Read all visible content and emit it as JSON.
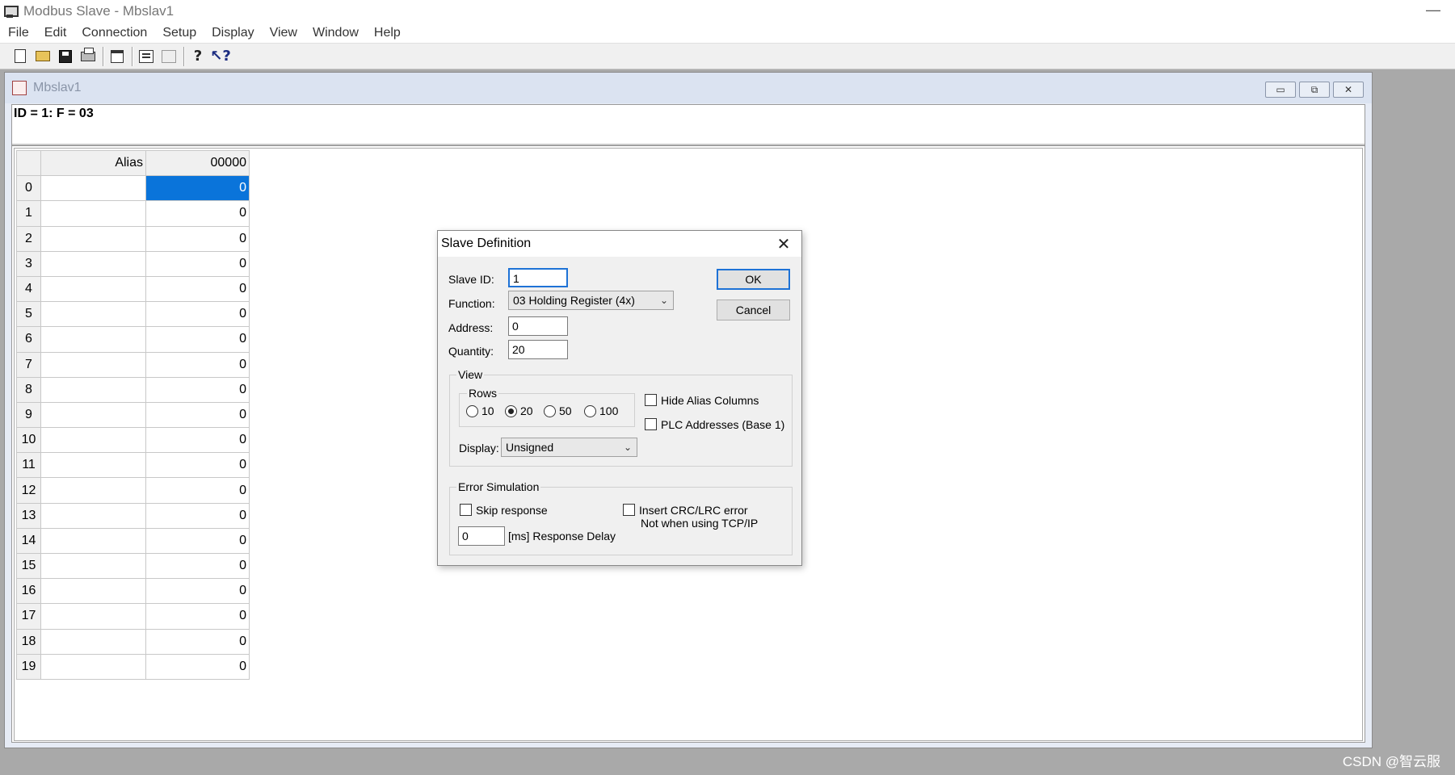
{
  "app": {
    "title": "Modbus Slave - Mbslav1",
    "minimize_glyph": "—"
  },
  "menu": [
    "File",
    "Edit",
    "Connection",
    "Setup",
    "Display",
    "View",
    "Window",
    "Help"
  ],
  "toolbar": {
    "icons": [
      "new-icon",
      "open-icon",
      "save-icon",
      "print-icon",
      "window-icon",
      "connect-icon",
      "disconnect-icon",
      "help-icon",
      "context-help-icon"
    ],
    "help_glyph": "?",
    "context_help_glyph": "↖?"
  },
  "child_window": {
    "title": "Mbslav1",
    "status": "ID = 1: F = 03",
    "btn_min": "▭",
    "btn_restore": "⧉",
    "btn_close": "✕"
  },
  "grid": {
    "col_alias": "Alias",
    "col_address": "00000",
    "rows": [
      "0",
      "1",
      "2",
      "3",
      "4",
      "5",
      "6",
      "7",
      "8",
      "9",
      "10",
      "11",
      "12",
      "13",
      "14",
      "15",
      "16",
      "17",
      "18",
      "19"
    ],
    "values": [
      "0",
      "0",
      "0",
      "0",
      "0",
      "0",
      "0",
      "0",
      "0",
      "0",
      "0",
      "0",
      "0",
      "0",
      "0",
      "0",
      "0",
      "0",
      "0",
      "0"
    ],
    "selected_row": 0
  },
  "dialog": {
    "title": "Slave Definition",
    "close_glyph": "✕",
    "slave_id_label": "Slave ID:",
    "slave_id_value": "1",
    "function_label": "Function:",
    "function_value": "03 Holding Register (4x)",
    "address_label": "Address:",
    "address_value": "0",
    "quantity_label": "Quantity:",
    "quantity_value": "20",
    "ok_label": "OK",
    "cancel_label": "Cancel",
    "view_group": "View",
    "rows_group": "Rows",
    "row_options": [
      "10",
      "20",
      "50",
      "100"
    ],
    "rows_selected": "20",
    "hide_alias_label": "Hide Alias Columns",
    "plc_addresses_label": "PLC Addresses (Base 1)",
    "display_label": "Display:",
    "display_value": "Unsigned",
    "error_group": "Error Simulation",
    "skip_response_label": "Skip response",
    "insert_crc_label": "Insert CRC/LRC error",
    "tcp_note": "Not when using TCP/IP",
    "delay_value": "0",
    "delay_label": "[ms] Response Delay",
    "chevron_glyph": "⌄"
  },
  "watermark": "CSDN @智云服",
  "colors": {
    "selection": "#0a74da",
    "focus_border": "#1e72d6",
    "desktop": "#a9a9a9"
  }
}
